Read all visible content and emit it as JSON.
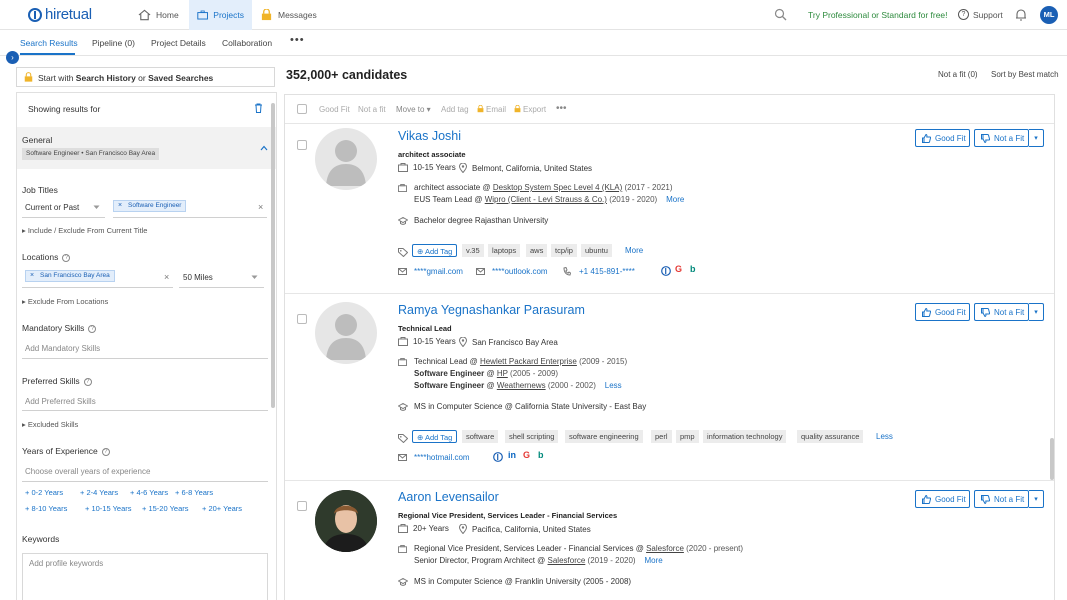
{
  "app": {
    "brand": "hiretual"
  },
  "nav": {
    "home": "Home",
    "projects": "Projects",
    "messages": "Messages",
    "promo": "Try Professional or Standard for free!",
    "support": "Support",
    "user_initials": "ML"
  },
  "subtabs": {
    "search_results": "Search Results",
    "pipeline": "Pipeline (0)",
    "project_details": "Project Details",
    "collaboration": "Collaboration",
    "more": "•••"
  },
  "left": {
    "history_prefix": "Start with ",
    "history_a": "Search History",
    "history_mid": " or ",
    "history_b": "Saved Searches",
    "showing_results": "Showing results for",
    "general": "General",
    "general_summary": "Software Engineer • San Francisco Bay Area",
    "job_titles": "Job Titles",
    "job_scope": "Current or Past",
    "job_chip": "Software Engineer",
    "include_exclude": "▸ Include / Exclude From Current Title",
    "locations": "Locations",
    "location_chip": "San Francisco Bay Area",
    "radius": "50 Miles",
    "exclude_locations": "▸ Exclude From Locations",
    "mandatory_skills": "Mandatory Skills",
    "mandatory_ph": "Add Mandatory Skills",
    "preferred_skills": "Preferred Skills",
    "preferred_ph": "Add Preferred Skills",
    "excluded_skills": "▸ Excluded Skills",
    "years_exp": "Years of Experience",
    "years_ph": "Choose overall years of experience",
    "year_options": [
      "+ 0-2 Years",
      "+ 2-4 Years",
      "+ 4-6 Years",
      "+ 6-8 Years",
      "+ 8-10 Years",
      "+ 10-15 Years",
      "+ 15-20 Years",
      "+ 20+ Years"
    ],
    "keywords": "Keywords",
    "keywords_ph": "Add profile keywords"
  },
  "results": {
    "count": "352,000+ candidates",
    "not_a_fit_count": "Not a fit (0)",
    "sort": "Sort by Best match",
    "toolbar": {
      "good_fit": "Good Fit",
      "not_a_fit": "Not a fit",
      "move_to": "Move to ▾",
      "add_tag": "Add tag",
      "email": "Email",
      "export": "Export",
      "more": "•••"
    },
    "btn_good_fit": "Good Fit",
    "btn_not_fit": "Not a Fit",
    "add_tag": "Add Tag",
    "candidates": [
      {
        "name": "Vikas Joshi",
        "title": "architect associate",
        "years": "10-15 Years",
        "location": "Belmont, California, United States",
        "exp1_role": "architect associate",
        "exp1_at": " @ ",
        "exp1_co": "Desktop System Spec Level 4 (KLA)",
        "exp1_dates": "(2017 - 2021)",
        "exp2_role": "EUS Team Lead",
        "exp2_at": " @ ",
        "exp2_co": "Wipro (Client - Levi Strauss & Co.)",
        "exp2_dates": "(2019 - 2020)",
        "more": "More",
        "education": "Bachelor degree Rajasthan University",
        "tags": [
          "v.35",
          "laptops",
          "aws",
          "tcp/ip",
          "ubuntu"
        ],
        "tags_more": "More",
        "email1": "****gmail.com",
        "email2": "****outlook.com",
        "phone": "+1 415-891-****"
      },
      {
        "name": "Ramya Yegnashankar Parasuram",
        "title": "Technical Lead",
        "years": "10-15 Years",
        "location": "San Francisco Bay Area",
        "exp1_role": "Technical Lead",
        "exp1_at": " @ ",
        "exp1_co": "Hewlett Packard Enterprise",
        "exp1_dates": "(2009 - 2015)",
        "exp2_role": "Software Engineer",
        "exp2_at": " @ ",
        "exp2_co": "HP",
        "exp2_dates": "(2005 - 2009)",
        "exp3_role": "Software Engineer",
        "exp3_at": " @ ",
        "exp3_co": "Weathernews",
        "exp3_dates": "(2000 - 2002)",
        "less": "Less",
        "education": "MS in Computer Science @ California State University - East Bay",
        "tags": [
          "software",
          "shell scripting",
          "software engineering",
          "perl",
          "pmp",
          "information technology",
          "quality assurance"
        ],
        "tags_less": "Less",
        "email1": "****hotmail.com"
      },
      {
        "name": "Aaron Levensailor",
        "title": "Regional Vice President, Services Leader - Financial Services",
        "years": "20+ Years",
        "location": "Pacifica, California, United States",
        "exp1_role": "Regional Vice President, Services Leader - Financial Services",
        "exp1_at": " @ ",
        "exp1_co": "Salesforce",
        "exp1_dates": "(2020 - present)",
        "exp2_role": "Senior Director, Program Architect",
        "exp2_at": " @ ",
        "exp2_co": "Salesforce",
        "exp2_dates": "(2019 - 2020)",
        "more": "More",
        "education": "MS in Computer Science @ Franklin University (2005 - 2008)"
      }
    ]
  },
  "colors": {
    "brand": "#1a5fb4",
    "link": "#1a73c8",
    "promo": "#2e8b3e"
  }
}
